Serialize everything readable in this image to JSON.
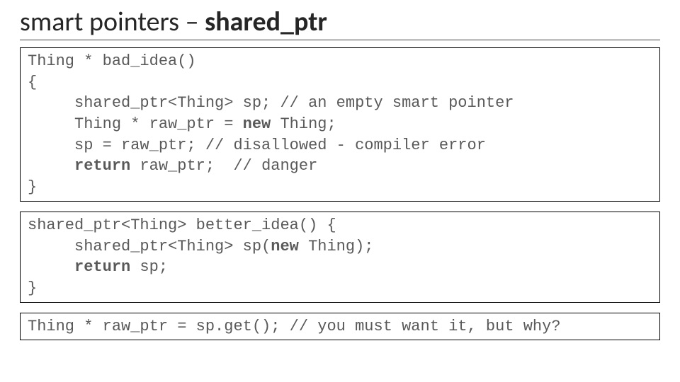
{
  "title_plain": "smart pointers – ",
  "title_bold": "shared_ptr",
  "code1": {
    "l1a": "Thing * bad_idea()",
    "l2a": "{",
    "l3a": "     shared_ptr<Thing> sp; // an empty smart pointer",
    "l4a": "     Thing * raw_ptr = ",
    "l4b": "new",
    "l4c": " Thing;",
    "l5a": "     sp = raw_ptr; // disallowed - compiler error",
    "l6a": "     ",
    "l6b": "return",
    "l6c": " raw_ptr;  // danger",
    "l7a": "}"
  },
  "code2": {
    "l1a": "shared_ptr<Thing> better_idea() {",
    "l2a": "     shared_ptr<Thing> sp(",
    "l2b": "new",
    "l2c": " Thing);",
    "l3a": "     ",
    "l3b": "return",
    "l3c": " sp;",
    "l4a": "}"
  },
  "code3": {
    "l1a": "Thing * raw_ptr = sp.get(); // you must want it, but why?"
  }
}
